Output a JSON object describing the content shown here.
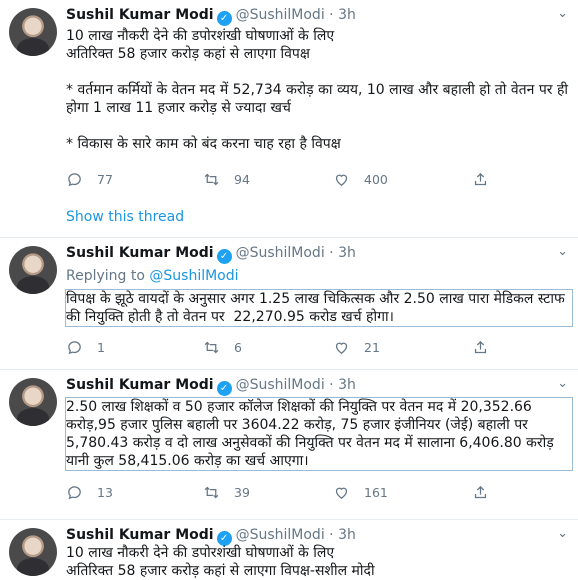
{
  "tweets": [
    {
      "name": "Sushil Kumar Modi",
      "handle": "@SushilModi",
      "sep": "·",
      "time": "3h",
      "text": "10 लाख नौकरी देने की डपोरशंखी घोषणाओं के लिए\nअतिरिक्त 58 हजार करोड़ कहां से लाएगा विपक्ष\n\n* वर्तमान कर्मियों के वेतन मद में 52,734 करोड़ का व्यय, 10 लाख और बहाली हो तो वेतन पर ही होगा 1 लाख 11 हजार करोड़ से ज्यादा खर्च\n\n* विकास के सारे काम को बंद करना चाह रहा है विपक्ष",
      "replies": "77",
      "retweets": "94",
      "likes": "400",
      "show_thread": "Show this thread"
    },
    {
      "name": "Sushil Kumar Modi",
      "handle": "@SushilModi",
      "sep": "·",
      "time": "3h",
      "replying_label": "Replying to",
      "replying_handle": "@SushilModi",
      "text": "विपक्ष के झूठे वायदों के अनुसार अगर 1.25 लाख चिकित्सक और 2.50 लाख पारा मेडिकल स्टाफ की नियुक्ति होती है तो वेतन पर  22,270.95 करोड खर्च होगा।",
      "replies": "1",
      "retweets": "6",
      "likes": "21"
    },
    {
      "name": "Sushil Kumar Modi",
      "handle": "@SushilModi",
      "sep": "·",
      "time": "3h",
      "text": "2.50 लाख शिक्षकों व 50 हजार कॉलेज शिक्षकों की नियुक्ति पर वेतन मद में 20,352.66 करोड़,95 हजार पुलिस बहाली पर 3604.22 करोड़, 75 हजार इंजीनियर (जेई) बहाली पर 5,780.43 करोड़ व दो लाख अनुसेवकों की नियुक्ति पर वेतन मद में सालाना 6,406.80 करोड़ यानी कुल 58,415.06 करोड़ का खर्च आएगा।",
      "replies": "13",
      "retweets": "39",
      "likes": "161"
    },
    {
      "name": "Sushil Kumar Modi",
      "handle": "@SushilModi",
      "sep": "·",
      "time": "3h",
      "text": "10 लाख नौकरी देने की डपोरशंखी घोषणाओं के लिए\nअतिरिक्त 58 हजार करोड़ कहां से लाएगा विपक्ष-सशील मोदी"
    }
  ]
}
